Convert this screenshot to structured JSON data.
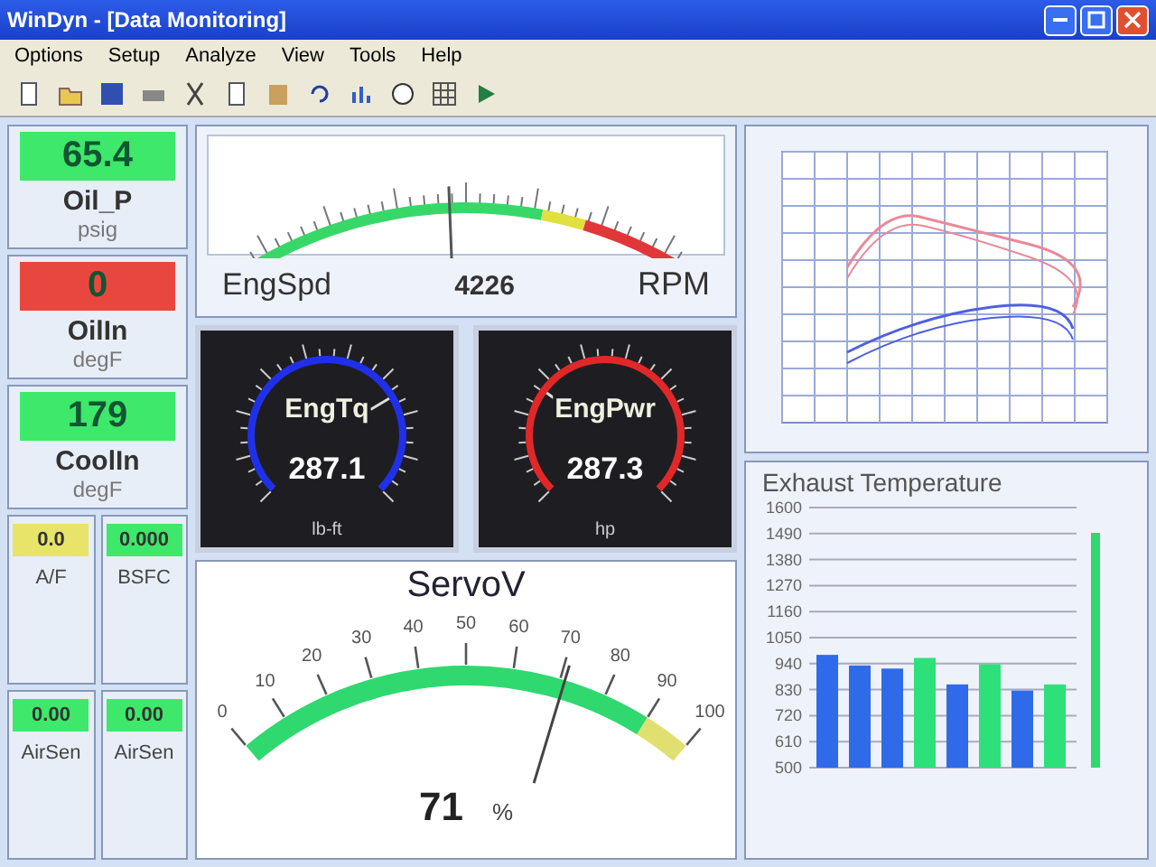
{
  "window": {
    "title": "WinDyn - [Data Monitoring]"
  },
  "menu": [
    "Options",
    "Setup",
    "Analyze",
    "View",
    "Tools",
    "Help"
  ],
  "tiles": [
    {
      "value": "65.4",
      "label": "Oil_P",
      "unit": "psig",
      "color": "#3ee86a"
    },
    {
      "value": "0",
      "label": "OilIn",
      "unit": "degF",
      "color": "#e8473f"
    },
    {
      "value": "179",
      "label": "CoolIn",
      "unit": "degF",
      "color": "#3ee86a"
    }
  ],
  "small_tiles": [
    {
      "value": "0.0",
      "label": "A/F",
      "color": "#e8e46a"
    },
    {
      "value": "0.000",
      "label": "BSFC",
      "color": "#3ee86a"
    },
    {
      "value": "0.00",
      "label": "AirSen",
      "color": "#3ee86a"
    },
    {
      "value": "0.00",
      "label": "AirSen",
      "color": "#3ee86a"
    }
  ],
  "eng_speed": {
    "label": "EngSpd",
    "value": "4226",
    "unit": "RPM",
    "level": 0.47
  },
  "dials": [
    {
      "label": "EngTq",
      "value": "287.1",
      "unit": "lb-ft",
      "color": "#2030e8",
      "level": 0.72
    },
    {
      "label": "EngPwr",
      "value": "287.3",
      "unit": "hp",
      "color": "#e02828",
      "level": 0.3
    }
  ],
  "servo": {
    "label": "ServoV",
    "ticks": [
      "0",
      "10",
      "20",
      "30",
      "40",
      "50",
      "60",
      "70",
      "80",
      "90",
      "100"
    ],
    "value": "71",
    "unit": "%",
    "level": 0.71
  },
  "exhaust": {
    "chart_data": {
      "type": "bar",
      "title": "Exhaust Temperature",
      "yticks": [
        500,
        610,
        720,
        830,
        940,
        1050,
        1160,
        1270,
        1380,
        1490,
        1600
      ],
      "ylim": [
        500,
        1600
      ],
      "grid": true,
      "series": [
        {
          "color": "#2f6be8",
          "values": [
            977,
            932,
            919,
            null,
            852,
            null,
            826,
            null
          ]
        },
        {
          "color": "#2ee07a",
          "values": [
            null,
            null,
            null,
            964,
            null,
            937,
            null,
            852
          ]
        }
      ]
    }
  }
}
